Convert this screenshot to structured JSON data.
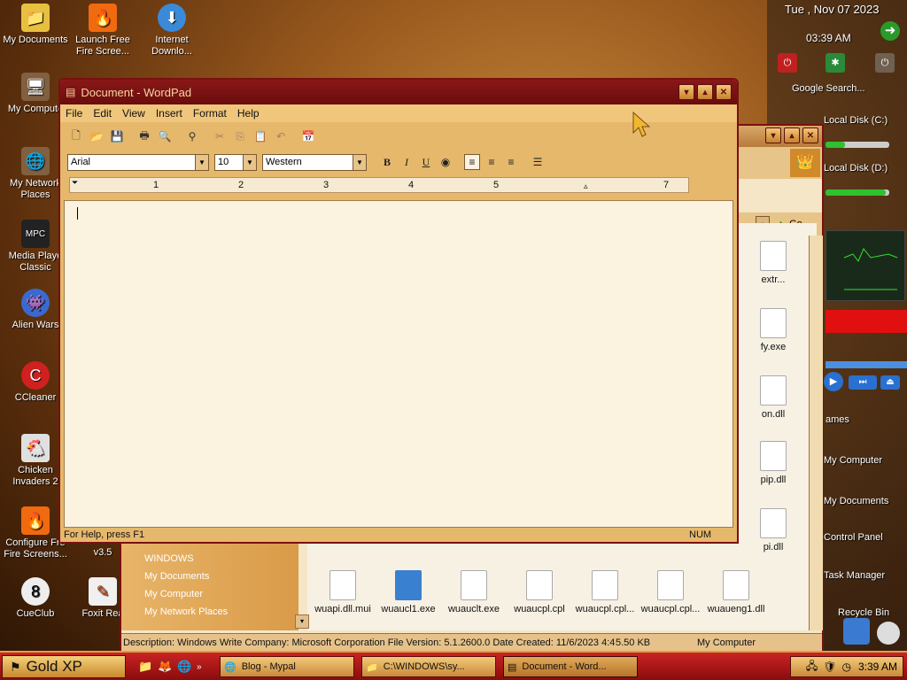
{
  "desktop": {
    "icons": [
      {
        "label": "My Documents",
        "icon": "folder-icon"
      },
      {
        "label": "Launch Free Fire Scree...",
        "icon": "fire-icon"
      },
      {
        "label": "Internet Downlo...",
        "icon": "globe-download-icon"
      },
      {
        "label": "My Compute",
        "icon": "computer-icon"
      },
      {
        "label": "My Network Places",
        "icon": "network-icon"
      },
      {
        "label": "Media Playe Classic",
        "icon": "media-player-icon"
      },
      {
        "label": "Alien Wars",
        "icon": "alien-icon"
      },
      {
        "label": "CCleaner",
        "icon": "ccleaner-icon"
      },
      {
        "label": "Chicken Invaders 2",
        "icon": "chicken-icon"
      },
      {
        "label": "Configure Fre Fire Screens...",
        "icon": "fire-icon"
      },
      {
        "label": "CueClub",
        "icon": "cueclub-icon"
      },
      {
        "label": "Foxit Rea",
        "icon": "foxit-icon"
      },
      {
        "label": "v3.5",
        "icon": ""
      }
    ]
  },
  "sidebar": {
    "date": "Tue , Nov 07 2023",
    "time": "03:39 AM",
    "search_placeholder": "Google Search...",
    "disk_c": "Local Disk (C:)",
    "disk_d": "Local Disk (D:)",
    "links": [
      "ames",
      "My Computer",
      "My Documents",
      "Control Panel",
      "Task Manager",
      "Recycle Bin"
    ]
  },
  "explorer": {
    "go_label": "Go",
    "partial_files": [
      "extr...",
      "fy.exe",
      "on.dll",
      "pip.dll",
      "pi.dll"
    ],
    "files": [
      "wuapi.dll.mui",
      "wuaucl1.exe",
      "wuauclt.exe",
      "wuaucpl.cpl",
      "wuaucpl.cpl...",
      "wuaucpl.cpl...",
      "wuaueng1.dll"
    ],
    "left_links": [
      "WINDOWS",
      "My Documents",
      "My Computer",
      "My Network Places"
    ],
    "status_desc": "Description: Windows Write Company: Microsoft Corporation File Version: 5.1.2600.0 Date Created: 11/6/2023 4:4",
    "status_size": "5.50 KB",
    "status_location": "My Computer"
  },
  "wordpad": {
    "title": "Document - WordPad",
    "menu": [
      "File",
      "Edit",
      "View",
      "Insert",
      "Format",
      "Help"
    ],
    "font": "Arial",
    "size": "10",
    "script": "Western",
    "ruler_numbers": [
      "1",
      "2",
      "3",
      "4",
      "5",
      "7"
    ],
    "status_help": "For Help, press F1",
    "status_num": "NUM"
  },
  "taskbar": {
    "start_label": "Gold XP",
    "tasks": [
      "Blog - Mypal",
      "C:\\WINDOWS\\sy...",
      "Document - Word..."
    ],
    "clock": "3:39 AM"
  }
}
